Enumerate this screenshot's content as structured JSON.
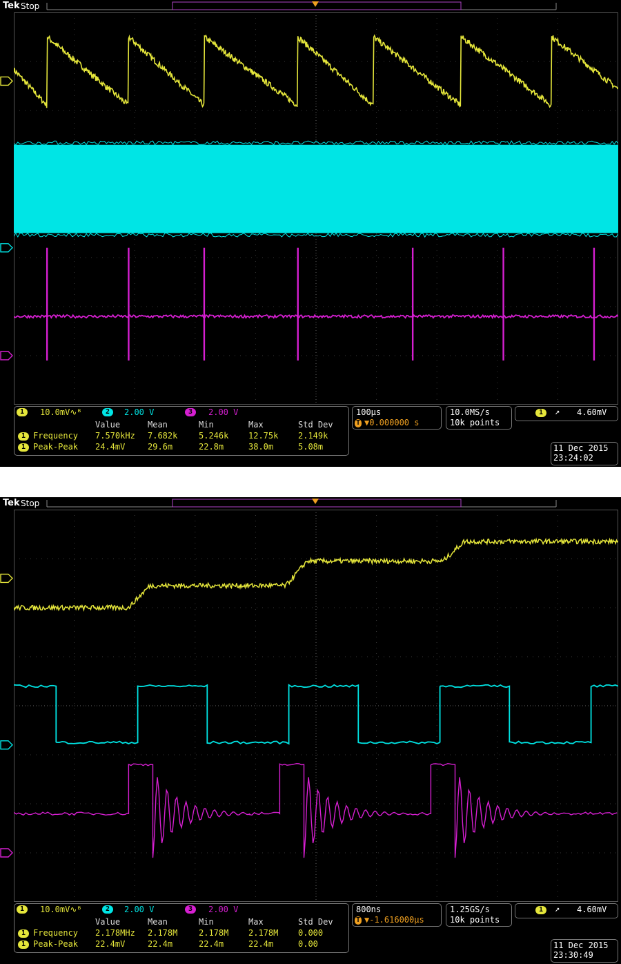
{
  "screens": [
    {
      "brand": "Tek",
      "state": "Stop",
      "channels": [
        {
          "badge": "1",
          "setting": "10.0mV∿ᴮ",
          "color": "#e5e63b"
        },
        {
          "badge": "2",
          "setting": "2.00 V",
          "color": "#00e5e5"
        },
        {
          "badge": "3",
          "setting": "2.00 V",
          "color": "#d61fd1"
        }
      ],
      "timebase": "100µs",
      "trigger_position": "▼0.000000 s",
      "sample_rate": "10.0MS/s",
      "record_length": "10k points",
      "trigger_channel": "1",
      "trigger_level": "4.60mV",
      "stats_headers": [
        "Value",
        "Mean",
        "Min",
        "Max",
        "Std Dev"
      ],
      "stats_rows": [
        {
          "badge": "1",
          "label": "Frequency",
          "value": "7.570kHz",
          "mean": "7.682k",
          "min": "5.246k",
          "max": "12.75k",
          "std": "2.149k"
        },
        {
          "badge": "1",
          "label": "Peak-Peak",
          "value": "24.4mV",
          "mean": "29.6m",
          "min": "22.8m",
          "max": "38.0m",
          "std": "5.08m"
        }
      ],
      "date": "11 Dec 2015",
      "time": "23:24:02"
    },
    {
      "brand": "Tek",
      "state": "Stop",
      "channels": [
        {
          "badge": "1",
          "setting": "10.0mV∿ᴮ",
          "color": "#e5e63b"
        },
        {
          "badge": "2",
          "setting": "2.00 V",
          "color": "#00e5e5"
        },
        {
          "badge": "3",
          "setting": "2.00 V",
          "color": "#d61fd1"
        }
      ],
      "timebase": "800ns",
      "trigger_position": "▼-1.616000µs",
      "sample_rate": "1.25GS/s",
      "record_length": "10k points",
      "trigger_channel": "1",
      "trigger_level": "4.60mV",
      "stats_headers": [
        "Value",
        "Mean",
        "Min",
        "Max",
        "Std Dev"
      ],
      "stats_rows": [
        {
          "badge": "1",
          "label": "Frequency",
          "value": "2.178MHz",
          "mean": "2.178M",
          "min": "2.178M",
          "max": "2.178M",
          "std": "0.000"
        },
        {
          "badge": "1",
          "label": "Peak-Peak",
          "value": "22.4mV",
          "mean": "22.4m",
          "min": "22.4m",
          "max": "22.4m",
          "std": "0.00"
        }
      ],
      "date": "11 Dec 2015",
      "time": "23:30:49"
    }
  ],
  "chart_data": [
    {
      "type": "line",
      "xlim": [
        0,
        10
      ],
      "ylim": [
        -4,
        4
      ],
      "grid": true,
      "series": [
        {
          "channel": "1",
          "color": "#e5e63b",
          "waveform": "sawtooth",
          "ramp_starts": [
            -0.5,
            0.55,
            1.9,
            3.15,
            4.7,
            5.95,
            7.4,
            8.9
          ],
          "high": 3.5,
          "low": 2.1
        },
        {
          "channel": "2",
          "color": "#00e5e5",
          "waveform": "dense_pwm",
          "high": 1.3,
          "low": -0.5
        },
        {
          "channel": "3",
          "color": "#d61fd1",
          "waveform": "spikes",
          "baseline": -2.2,
          "spike_x": [
            0.55,
            1.9,
            3.15,
            4.7,
            6.6,
            8.1,
            9.6
          ],
          "spike_top": -0.8,
          "spike_bottom": -3.1
        }
      ]
    },
    {
      "type": "line",
      "xlim": [
        0,
        10
      ],
      "ylim": [
        -4,
        4
      ],
      "grid": true,
      "series": [
        {
          "channel": "1",
          "color": "#e5e63b",
          "waveform": "staircase",
          "steps_x": [
            0,
            1.9,
            4.5,
            7.1
          ],
          "levels": [
            2.0,
            2.45,
            2.95,
            3.35
          ]
        },
        {
          "channel": "2",
          "color": "#00e5e5",
          "waveform": "square",
          "edges_x": [
            0.7,
            2.05,
            3.2,
            4.55,
            5.7,
            7.05,
            8.2,
            9.55
          ],
          "high": 0.4,
          "low": -0.75,
          "start_level": "high"
        },
        {
          "channel": "3",
          "color": "#d61fd1",
          "waveform": "ringing",
          "baseline": -2.2,
          "pulses": [
            [
              1.9,
              2.3
            ],
            [
              4.4,
              4.8
            ],
            [
              6.9,
              7.3
            ]
          ],
          "pulse_high": -1.2,
          "pulse_low": -3.1
        }
      ]
    }
  ]
}
